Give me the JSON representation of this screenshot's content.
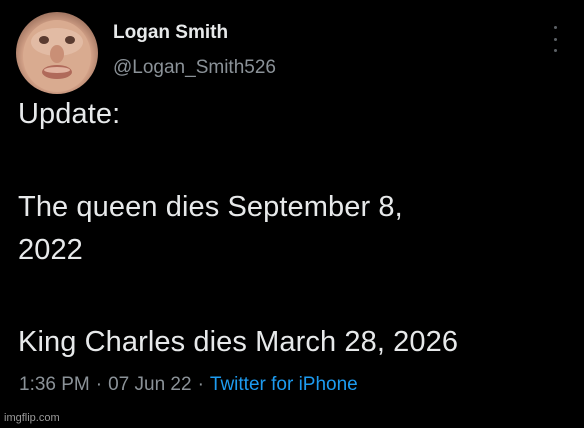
{
  "author": {
    "display_name": "Logan Smith",
    "handle": "@Logan_Smith526"
  },
  "tweet": {
    "lines": [
      "Update:",
      "The queen dies September 8,",
      "2022",
      "King Charles dies March 28, 2026"
    ],
    "time": "1:36 PM",
    "separator": "·",
    "date": "07 Jun 22",
    "source": "Twitter for iPhone"
  },
  "watermark": "imgflip.com",
  "icons": {
    "more": "vertical-ellipsis-icon",
    "avatar": "face-photo"
  },
  "colors": {
    "background": "#000000",
    "text": "#e7e9ea",
    "secondary": "#8b9298",
    "link": "#1d9bf0"
  }
}
